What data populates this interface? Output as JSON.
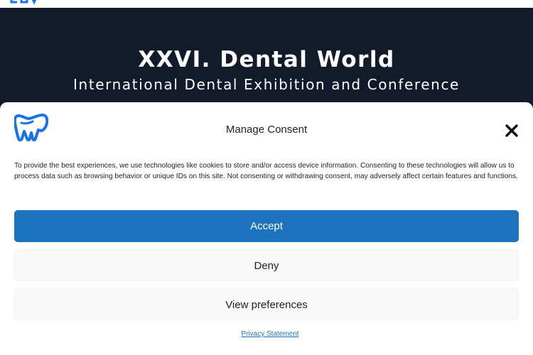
{
  "hero": {
    "title": "XXVI. Dental World",
    "subtitle": "International Dental Exhibition and Conference"
  },
  "consent": {
    "title": "Manage Consent",
    "description": "To provide the best experiences, we use technologies like cookies to store and/or access device information. Consenting to these technologies will allow us to process data such as browsing behavior or unique IDs on this site. Not consenting or withdrawing consent, may adversely affect certain features and functions.",
    "accept_label": "Accept",
    "deny_label": "Deny",
    "preferences_label": "View preferences",
    "privacy_link": "Privacy Statement",
    "close_icon": "close-icon",
    "logo_icon": "dental-world-logo"
  },
  "colors": {
    "hero_background": "#131a2c",
    "accent": "#1e73be",
    "logo_blue": "#1a73e8",
    "button_light": "#f9f9f9"
  }
}
